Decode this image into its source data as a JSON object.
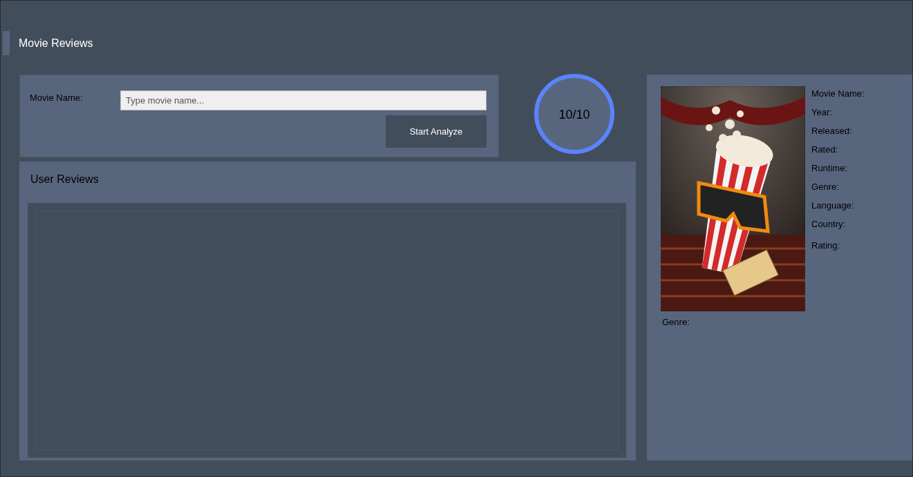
{
  "window": {
    "title": "Movie Reviews"
  },
  "search": {
    "label": "Movie Name:",
    "placeholder": "Type movie name...",
    "button": "Start Analyze"
  },
  "score": {
    "text": "10/10",
    "level": 1
  },
  "reviews": {
    "title": "User Reviews"
  },
  "details": {
    "fields": [
      "Movie Name:",
      "Year:",
      "Released:",
      "Rated:",
      "Runtime:",
      "Genre:",
      "Language:",
      "Country:",
      "Rating:"
    ],
    "poster_caption": "Genre:"
  }
}
